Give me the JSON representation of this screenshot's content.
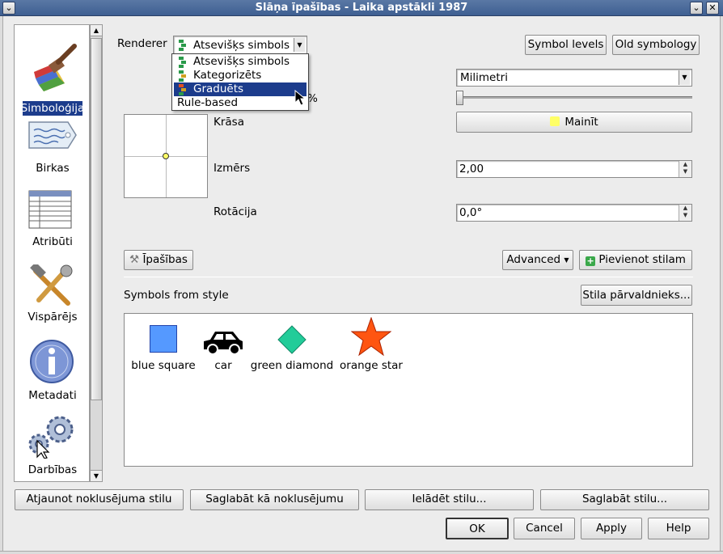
{
  "window": {
    "title": "Slāņa īpašības - Laika apstākli 1987"
  },
  "sidebar": {
    "items": [
      {
        "label": "Simboloģija",
        "icon": "brush-icon",
        "selected": true
      },
      {
        "label": "Birkas",
        "icon": "tag-icon"
      },
      {
        "label": "Atribūti",
        "icon": "table-icon"
      },
      {
        "label": "Vispārējs",
        "icon": "tools-icon"
      },
      {
        "label": "Metadati",
        "icon": "info-icon"
      },
      {
        "label": "Darbības",
        "icon": "gears-icon"
      }
    ]
  },
  "renderer": {
    "label": "Renderer",
    "selected": "Atsevišķs simbols",
    "options": [
      "Atsevišķs simbols",
      "Kategorizēts",
      "Graduēts",
      "Rule-based"
    ],
    "highlighted": "Graduēts"
  },
  "top_buttons": {
    "symbol_levels": "Symbol levels",
    "old_symbology": "Old symbology"
  },
  "unit": {
    "value": "Milimetri"
  },
  "transparency": {
    "suffix": "%",
    "value_percent": 0
  },
  "color": {
    "label": "Krāsa",
    "button": "Mainīt",
    "swatch": "#ffff66"
  },
  "size": {
    "label": "Izmērs",
    "value": "2,00"
  },
  "rotation": {
    "label": "Rotācija",
    "value": "0,0°"
  },
  "actions": {
    "properties": "Īpašības",
    "advanced": "Advanced",
    "add_to_style": "Pievienot stilam"
  },
  "symbols": {
    "heading": "Symbols from style",
    "manager_button": "Stila pārvaldnieks...",
    "items": [
      {
        "label": "blue square",
        "icon": "blue-square-icon",
        "color": "#5599ff"
      },
      {
        "label": "car",
        "icon": "car-icon",
        "color": "#000000"
      },
      {
        "label": "green diamond",
        "icon": "green-diamond-icon",
        "color": "#22cc99"
      },
      {
        "label": "orange star",
        "icon": "orange-star-icon",
        "color": "#ff5511"
      }
    ]
  },
  "style_buttons": {
    "restore_default": "Atjaunot noklusējuma stilu",
    "save_default": "Saglabāt kā noklusējumu",
    "load_style": "Ielādēt stilu...",
    "save_style": "Saglabāt stilu..."
  },
  "dialog_buttons": {
    "ok": "OK",
    "cancel": "Cancel",
    "apply": "Apply",
    "help": "Help"
  }
}
